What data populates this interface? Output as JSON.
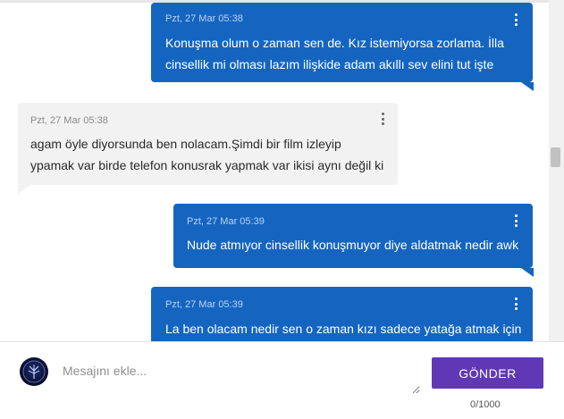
{
  "messages": [
    {
      "direction": "sent",
      "timestamp": "Pzt, 27 Mar 05:38",
      "lines": [
        "Konuşma olum o zaman sen de. Kız istemiyorsa zorlama. İlla",
        "cinsellik mi olması lazım ilişkide adam akıllı sev elini tut işte"
      ]
    },
    {
      "direction": "received",
      "timestamp": "Pzt, 27 Mar 05:38",
      "lines": [
        "agam öyle diyorsunda ben nolacam.Şimdi bir film izleyip",
        "ypamak var birde telefon konusrak yapmak var ikisi aynı değil ki"
      ]
    },
    {
      "direction": "sent",
      "timestamp": "Pzt, 27 Mar 05:39",
      "lines": [
        "Nude atmıyor cinsellik konuşmuyor diye aldatmak nedir awk"
      ]
    },
    {
      "direction": "sent",
      "timestamp": "Pzt, 27 Mar 05:39",
      "lines": [
        "La ben olacam nedir sen o zaman kızı sadece yatağa atmak için"
      ]
    }
  ],
  "composer": {
    "placeholder": "Mesajını ekle...",
    "value": "",
    "send_label": "GÖNDER",
    "char_count": "0/1000"
  },
  "colors": {
    "sent_bubble": "#1565c0",
    "received_bubble": "#f2f2f2",
    "send_button": "#6038b5"
  },
  "icons": {
    "message_menu": "more-vertical-icon",
    "avatar": "user-avatar-tree"
  }
}
